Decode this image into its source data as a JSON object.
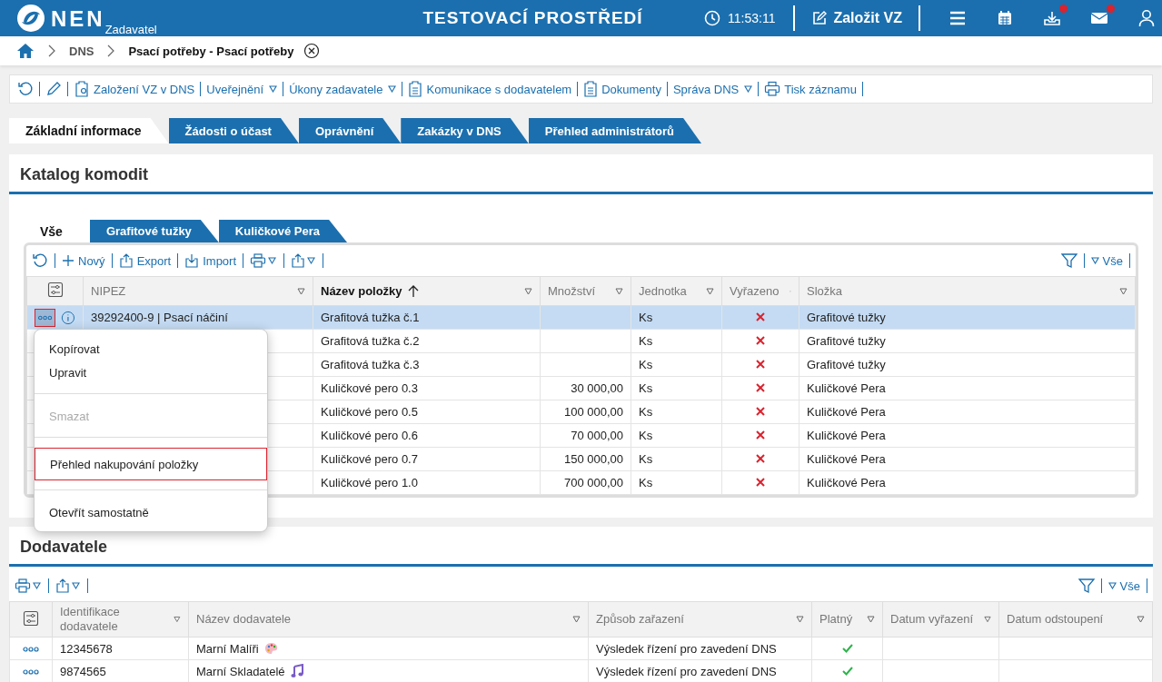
{
  "header": {
    "logo": "NEN",
    "subtitle": "Zadavatel",
    "environment": "TESTOVACÍ PROSTŘEDÍ",
    "time": "11:53:11",
    "create_button": "Založit VZ",
    "icons": [
      {
        "kind": "menu",
        "alert": false
      },
      {
        "kind": "calendar",
        "alert": false
      },
      {
        "kind": "download",
        "alert": true
      },
      {
        "kind": "mail",
        "alert": true
      },
      {
        "kind": "user",
        "alert": false
      }
    ]
  },
  "breadcrumb": [
    {
      "label": "DNS",
      "current": false
    },
    {
      "label": "Psací potřeby - Psací potřeby",
      "current": true
    }
  ],
  "actions": [
    {
      "kind": "refresh",
      "dropdown": false
    },
    {
      "kind": "edit",
      "dropdown": false
    },
    {
      "kind": "settings",
      "label": "Založení VZ v DNS",
      "dropdown": false
    },
    {
      "kind": "text",
      "label": "Uveřejnění",
      "dropdown": true
    },
    {
      "kind": "text",
      "label": "Úkony zadavatele",
      "dropdown": true
    },
    {
      "kind": "document",
      "label": "Komunikace s dodavatelem",
      "dropdown": false
    },
    {
      "kind": "document",
      "label": "Dokumenty",
      "dropdown": false
    },
    {
      "kind": "text",
      "label": "Správa DNS",
      "dropdown": true
    },
    {
      "kind": "print",
      "label": "Tisk záznamu",
      "dropdown": false
    }
  ],
  "tabs": [
    {
      "label": "Základní informace",
      "selected": true
    },
    {
      "label": "Žádosti o účast",
      "selected": false
    },
    {
      "label": "Oprávnění",
      "selected": false
    },
    {
      "label": "Zakázky v DNS",
      "selected": false
    },
    {
      "label": "Přehled administrátorů",
      "selected": false
    }
  ],
  "catalog": {
    "title": "Katalog komodit",
    "tabs": [
      {
        "label": "Vše",
        "selected": true
      },
      {
        "label": "Grafitové tužky",
        "selected": false
      },
      {
        "label": "Kuličkové Pera",
        "selected": false
      }
    ],
    "toolbar": {
      "new": "Nový",
      "export": "Export",
      "import": "Import",
      "filter_all": "Vše"
    },
    "columns": [
      {
        "label": "NIPEZ",
        "sorted": false
      },
      {
        "label": "Název položky",
        "sorted": true
      },
      {
        "label": "Množství",
        "sorted": false
      },
      {
        "label": "Jednotka",
        "sorted": false
      },
      {
        "label": "Vyřazeno",
        "sorted": false
      },
      {
        "label": "Složka",
        "sorted": false
      }
    ],
    "rows": [
      {
        "nipez": "39292400-9 | Psací náčiní",
        "name": "Grafitová tužka č.1",
        "unit": "Ks",
        "excluded": true,
        "folder": "Grafitové tužky",
        "selected": true
      },
      {
        "name": "Grafitová tužka č.2",
        "unit": "Ks",
        "excluded": true,
        "folder": "Grafitové tužky",
        "selected": false
      },
      {
        "name": "Grafitová tužka č.3",
        "unit": "Ks",
        "excluded": true,
        "folder": "Grafitové tužky",
        "selected": false
      },
      {
        "name": "Kuličkové pero 0.3",
        "quantity": "30 000,00",
        "unit": "Ks",
        "excluded": true,
        "folder": "Kuličkové Pera",
        "selected": false
      },
      {
        "name": "Kuličkové pero 0.5",
        "quantity": "100 000,00",
        "unit": "Ks",
        "excluded": true,
        "folder": "Kuličkové Pera",
        "selected": false
      },
      {
        "name": "Kuličkové pero 0.6",
        "quantity": "70 000,00",
        "unit": "Ks",
        "excluded": true,
        "folder": "Kuličkové Pera",
        "selected": false
      },
      {
        "name": "Kuličkové pero 0.7",
        "quantity": "150 000,00",
        "unit": "Ks",
        "excluded": true,
        "folder": "Kuličkové Pera",
        "selected": false
      },
      {
        "name": "Kuličkové pero 1.0",
        "quantity": "700 000,00",
        "unit": "Ks",
        "excluded": true,
        "folder": "Kuličkové Pera",
        "selected": false
      }
    ]
  },
  "context_menu": {
    "items": [
      {
        "label": "Kopírovat",
        "disabled": false,
        "highlighted": false,
        "separator_before": false
      },
      {
        "label": "Upravit",
        "disabled": false,
        "highlighted": false,
        "separator_before": false
      },
      {
        "label": "Smazat",
        "disabled": true,
        "highlighted": false,
        "separator_before": true
      },
      {
        "label": "Přehled nakupování položky",
        "disabled": false,
        "highlighted": true,
        "separator_before": true
      },
      {
        "label": "Otevřít samostatně",
        "disabled": false,
        "highlighted": false,
        "separator_before": true
      }
    ]
  },
  "suppliers": {
    "title": "Dodavatele",
    "filter_all": "Vše",
    "columns": [
      {
        "label": "Identifikace dodavatele"
      },
      {
        "label": "Název dodavatele"
      },
      {
        "label": "Způsob zařazení"
      },
      {
        "label": "Platný"
      },
      {
        "label": "Datum vyřazení"
      },
      {
        "label": "Datum odstoupení"
      }
    ],
    "rows": [
      {
        "id": "12345678",
        "name": "Marní Malíři",
        "kind": "palette",
        "method": "Výsledek řízení pro zavedení DNS",
        "valid": true
      },
      {
        "id": "9874565",
        "name": "Marní Skladatelé",
        "kind": "note",
        "method": "Výsledek řízení pro zavedení DNS",
        "valid": true
      }
    ]
  }
}
